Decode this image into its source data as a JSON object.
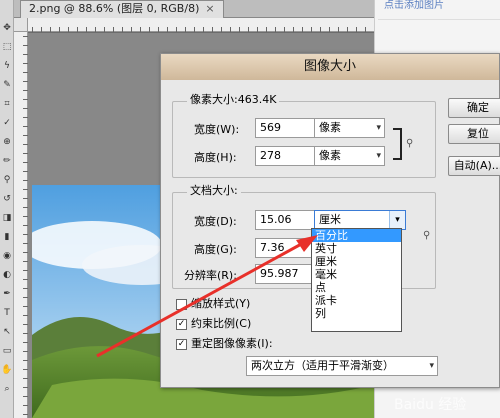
{
  "document": {
    "tab_title": "2.png @ 88.6% (图层 0, RGB/8)",
    "close_symbol": "×"
  },
  "right_panel": {
    "link": "点击添加图片"
  },
  "toolbar": [
    "move-tool",
    "marquee-tool",
    "lasso-tool",
    "quick-select-tool",
    "crop-tool",
    "eyedropper-tool",
    "healing-tool",
    "brush-tool",
    "clone-tool",
    "history-brush-tool",
    "eraser-tool",
    "gradient-tool",
    "blur-tool",
    "dodge-tool",
    "pen-tool",
    "type-tool",
    "path-select-tool",
    "shape-tool",
    "hand-tool",
    "zoom-tool"
  ],
  "dialog": {
    "title": "图像大小",
    "pixel_size": {
      "legend": "像素大小:463.4K",
      "width_label": "宽度(W):",
      "width_value": "569",
      "width_unit": "像素",
      "height_label": "高度(H):",
      "height_value": "278",
      "height_unit": "像素"
    },
    "doc_size": {
      "legend": "文档大小:",
      "width_label": "宽度(D):",
      "width_value": "15.06",
      "width_unit": "厘米",
      "height_label": "高度(G):",
      "height_value": "7.36",
      "resolution_label": "分辨率(R):",
      "resolution_value": "95.987"
    },
    "buttons": {
      "ok": "确定",
      "reset": "复位",
      "auto": "自动(A)..."
    },
    "checkboxes": {
      "scale_styles": {
        "label": "缩放样式(Y)",
        "checked": false
      },
      "constrain": {
        "label": "约束比例(C)",
        "checked": true
      },
      "resample": {
        "label": "重定图像像素(I):",
        "checked": true
      }
    },
    "resample_method": "两次立方（适用于平滑渐变）",
    "unit_options": [
      "百分比",
      "英寸",
      "厘米",
      "毫米",
      "点",
      "派卡",
      "列"
    ],
    "unit_selected_index": 0
  },
  "watermark": "Baidu 经验"
}
